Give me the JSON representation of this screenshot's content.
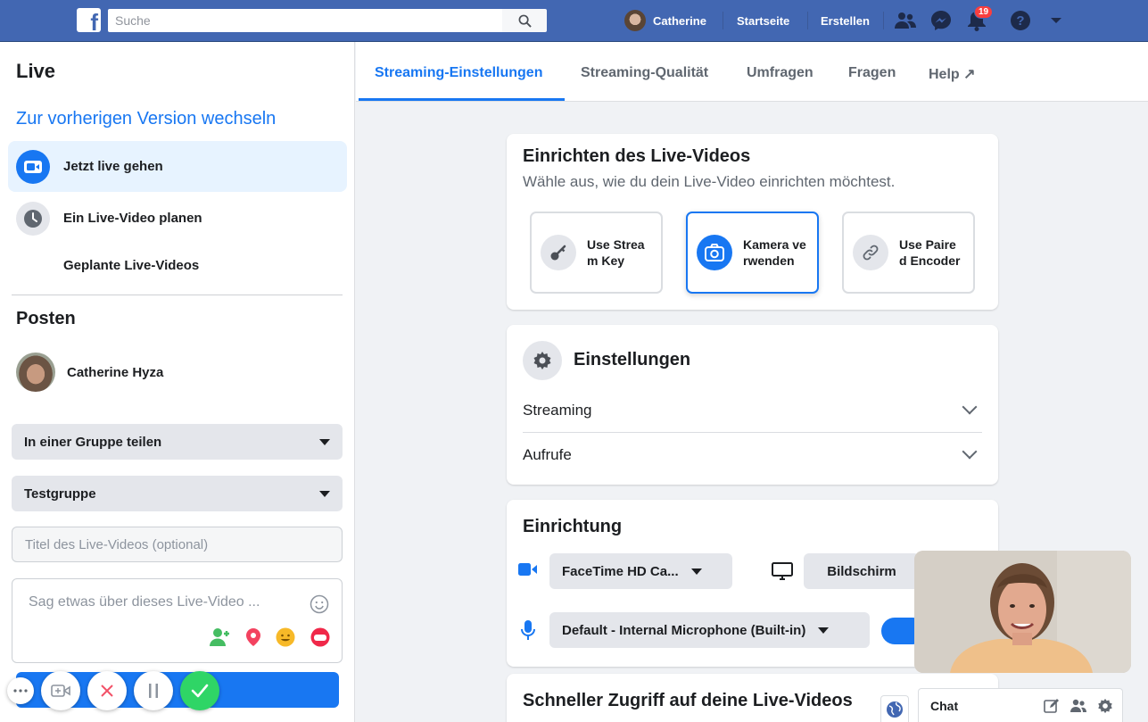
{
  "topbar": {
    "search_placeholder": "Suche",
    "user_name": "Catherine",
    "home_label": "Startseite",
    "create_label": "Erstellen",
    "notification_count": "19"
  },
  "sidebar": {
    "title": "Live",
    "switch_link": "Zur vorherigen Version wechseln",
    "items": [
      {
        "label": "Jetzt live gehen",
        "icon": "video-camera-icon"
      },
      {
        "label": "Ein Live-Video planen",
        "icon": "clock-icon"
      },
      {
        "label": "Geplante Live-Videos"
      }
    ],
    "post_title": "Posten",
    "post_user": "Catherine Hyza",
    "share_select": "In einer Gruppe teilen",
    "group_select": "Testgruppe",
    "title_placeholder": "Titel des Live-Videos (optional)",
    "description_placeholder": "Sag etwas über dieses Live-Video ..."
  },
  "tabs": [
    {
      "label": "Streaming-Einstellungen",
      "active": true
    },
    {
      "label": "Streaming-Qualität"
    },
    {
      "label": "Umfragen"
    },
    {
      "label": "Fragen"
    },
    {
      "label": "Help ↗"
    }
  ],
  "setup_card": {
    "title": "Einrichten des Live-Videos",
    "subtitle": "Wähle aus, wie du dein Live-Video einrichten möchtest.",
    "options": [
      {
        "label": "Use Stream Key",
        "icon": "key-icon"
      },
      {
        "label": "Kamera verwenden",
        "icon": "camera-icon",
        "selected": true
      },
      {
        "label": "Use Paired Encoder",
        "icon": "link-icon"
      }
    ]
  },
  "settings_card": {
    "title": "Einstellungen",
    "rows": [
      "Streaming",
      "Aufrufe"
    ]
  },
  "device_card": {
    "title": "Einrichtung",
    "camera_select": "FaceTime HD Ca...",
    "screen_button": "Bildschirm",
    "mic_select": "Default - Internal Microphone (Built-in)"
  },
  "quick_access_card": {
    "title": "Schneller Zugriff auf deine Live-Videos"
  },
  "chat": {
    "label": "Chat"
  },
  "colors": {
    "brand": "#4267b2",
    "accent": "#1877f2",
    "record_confirm": "#2fd566",
    "record_cancel": "#f25268"
  }
}
